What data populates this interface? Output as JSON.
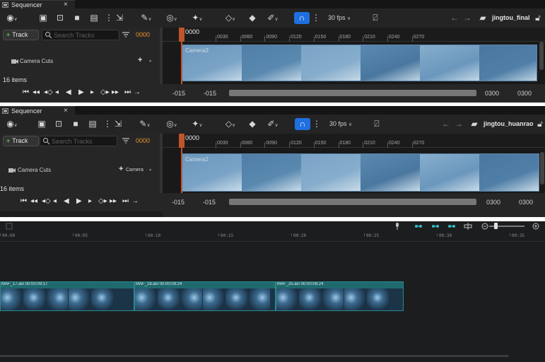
{
  "panels": [
    {
      "tab_title": "Sequencer",
      "tab_close": "×",
      "fps": "30 fps",
      "sequence_name": "jingtou_final",
      "add_track": "Track",
      "search_placeholder": "Search Tracks",
      "current_time": "0000",
      "track_name": "Camera Cuts",
      "track_add_label": "",
      "items_count": "16 items",
      "ruler_time": "0000",
      "ruler_ticks": [
        "0030",
        "0060",
        "0090",
        "0120",
        "0150",
        "0180",
        "0210",
        "0240",
        "0270"
      ],
      "shot_label": "Camera3",
      "range_start_outer": "-015",
      "range_start_inner": "-015",
      "range_end_inner": "0300",
      "range_end_outer": "0300"
    },
    {
      "tab_title": "Sequencer",
      "tab_close": "×",
      "fps": "30 fps",
      "sequence_name": "jingtou_huanrao",
      "add_track": "Track",
      "search_placeholder": "Search Tracks",
      "current_time": "0000",
      "track_name": "Camera Cuts",
      "track_add_label": "Camera",
      "items_count": "16 items",
      "ruler_time": "0000",
      "ruler_ticks": [
        "0030",
        "0060",
        "0090",
        "0120",
        "0150",
        "0180",
        "0210",
        "0240",
        "0270"
      ],
      "shot_label": "Camera2",
      "range_start_outer": "-015",
      "range_start_inner": "-015",
      "range_end_inner": "0300",
      "range_end_outer": "0300"
    }
  ],
  "editor": {
    "ruler_ticks": [
      "00:00",
      "00:05",
      "00:10",
      "00:15",
      "00:20",
      "00:25",
      "00:30",
      "00:35"
    ],
    "clips": [
      {
        "name": "MAF_17.avi",
        "duration": "00:00:09:17"
      },
      {
        "name": "MAF_18.avi",
        "duration": "00:00:09:24"
      },
      {
        "name": "MAF_25.avi",
        "duration": "00:00:08:24"
      }
    ]
  },
  "colors": {
    "accent_blue": "#1f6fe0",
    "playhead": "#c0552c",
    "time_orange": "#e2922f",
    "add_green": "#52c24a",
    "clip_teal": "#1f6a6e"
  }
}
